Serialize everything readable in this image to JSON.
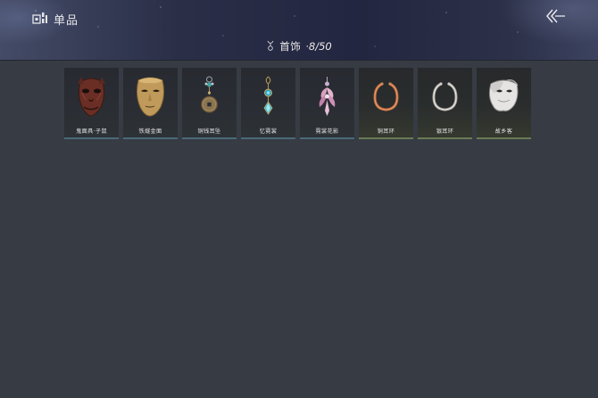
{
  "header": {
    "title": "单品",
    "title_icon": "collection-icon",
    "back_icon": "double-chevron-left-icon"
  },
  "category": {
    "icon": "pendant-icon",
    "label": "首饰",
    "count": "·8/50"
  },
  "items": [
    {
      "name": "鬼面具·子鼠",
      "icon": "rat-mask-icon",
      "frame": "blue"
    },
    {
      "name": "铁燧金面",
      "icon": "gold-mask-icon",
      "frame": "blue"
    },
    {
      "name": "铜钱耳坠",
      "icon": "coin-earring-icon",
      "frame": "blue"
    },
    {
      "name": "忆霓裳",
      "icon": "blue-pendant-icon",
      "frame": "blue"
    },
    {
      "name": "霓裳花影",
      "icon": "flower-pendant-icon",
      "frame": "blue"
    },
    {
      "name": "铜耳环",
      "icon": "copper-ring-icon",
      "frame": "green"
    },
    {
      "name": "银耳环",
      "icon": "silver-ring-icon",
      "frame": "green"
    },
    {
      "name": "故乡客",
      "icon": "white-mask-icon",
      "frame": "green"
    }
  ],
  "colors": {
    "background": "#373b43",
    "header": "#232640",
    "frame_blue": "#4a6a7a",
    "frame_green": "#6a7a55"
  }
}
